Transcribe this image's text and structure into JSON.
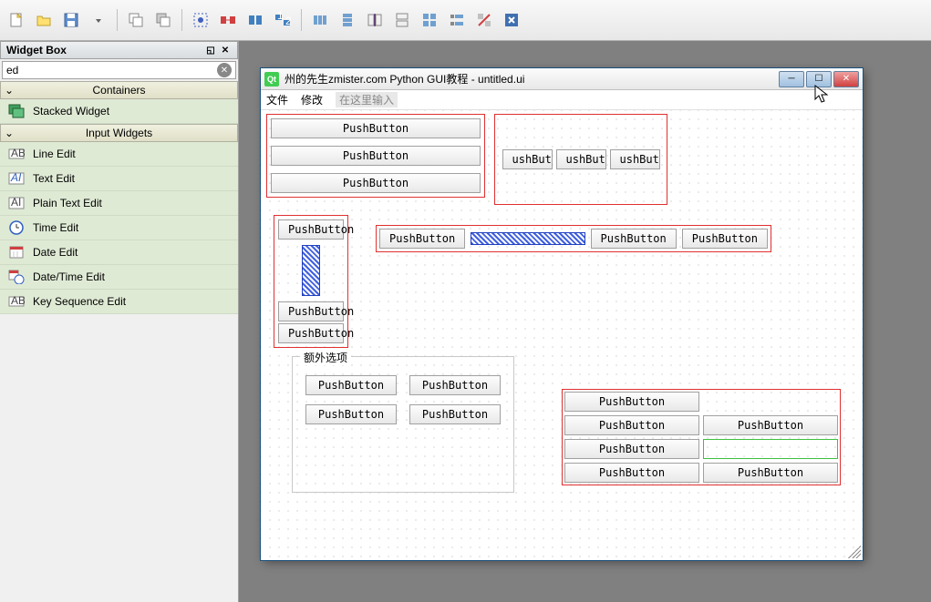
{
  "widgetBox": {
    "title": "Widget Box",
    "searchValue": "ed",
    "categories": {
      "containers": {
        "label": "Containers",
        "items": [
          "Stacked Widget"
        ]
      },
      "inputWidgets": {
        "label": "Input Widgets",
        "items": [
          "Line Edit",
          "Text Edit",
          "Plain Text Edit",
          "Time Edit",
          "Date Edit",
          "Date/Time Edit",
          "Key Sequence Edit"
        ]
      }
    }
  },
  "form": {
    "windowTitle": "州的先生zmister.com Python GUI教程 - untitled.ui",
    "menus": {
      "file": "文件",
      "edit": "修改",
      "typeHere": "在这里输入"
    },
    "pushButtonLabel": "PushButton",
    "shortPushLabel": "ushButton",
    "groupBoxTitle": "额外选项"
  }
}
